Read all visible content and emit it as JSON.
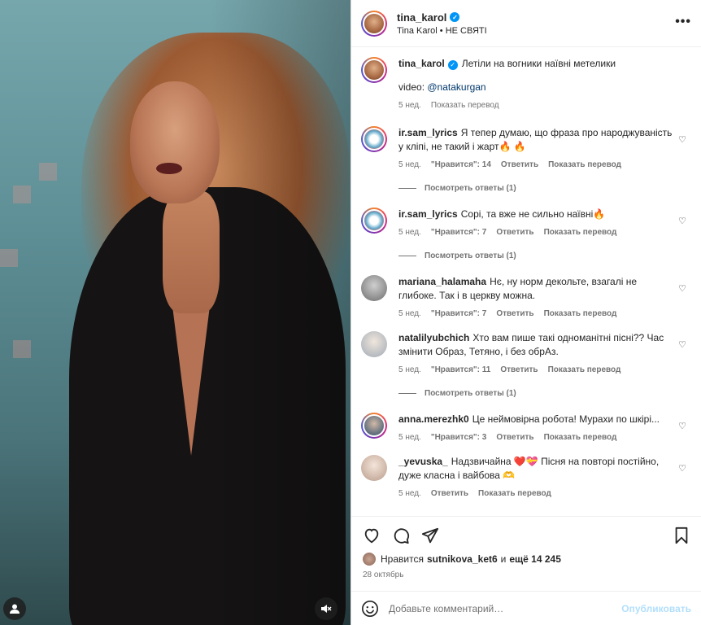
{
  "post": {
    "username": "tina_karol",
    "subtitle": "Tina Karol • НЕ СВЯТІ",
    "caption": "Летіли на вогники наївні метелики",
    "caption_video_prefix": "video: ",
    "caption_video_link": "@natakurgan",
    "caption_time": "5 нед.",
    "translate": "Показать перевод"
  },
  "comments": [
    {
      "user": "ir.sam_lyrics",
      "text": "Я тепер думаю, що фраза про народжуваність у кліпі, не такий і жарт🔥 🔥",
      "time": "5 нед.",
      "likes": "\"Нравится\": 14",
      "reply": "Ответить",
      "translate": "Показать перевод",
      "replies": "Посмотреть ответы (1)"
    },
    {
      "user": "ir.sam_lyrics",
      "text": "Сорі, та вже не сильно наївні🔥",
      "time": "5 нед.",
      "likes": "\"Нравится\": 7",
      "reply": "Ответить",
      "translate": "Показать перевод",
      "replies": "Посмотреть ответы (1)"
    },
    {
      "user": "mariana_halamaha",
      "text": "Нє, ну норм декольте, взагалі не глибоке. Так і в церкву можна.",
      "time": "5 нед.",
      "likes": "\"Нравится\": 7",
      "reply": "Ответить",
      "translate": "Показать перевод"
    },
    {
      "user": "natalilyubchich",
      "text": "Хто вам пише такі одноманітні пісні?? Час змінити Образ, Тетяно, і без обрАз.",
      "time": "5 нед.",
      "likes": "\"Нравится\": 11",
      "reply": "Ответить",
      "translate": "Показать перевод",
      "replies": "Посмотреть ответы (1)"
    },
    {
      "user": "anna.merezhk0",
      "text": "Це неймовірна робота! Мурахи по шкірі...",
      "time": "5 нед.",
      "likes": "\"Нравится\": 3",
      "reply": "Ответить",
      "translate": "Показать перевод"
    },
    {
      "user": "_yevuska_",
      "text": "Надзвичайна ❤️💝 Пісня на повторі постійно, дуже класна і вайбова 🫶",
      "time": "5 нед.",
      "reply": "Ответить",
      "translate": "Показать перевод"
    }
  ],
  "footer": {
    "likes_prefix": "Нравится",
    "likes_user": "sutnikova_ket6",
    "likes_and": "и",
    "likes_more": "ещё 14 245",
    "date": "28 октябрь",
    "comment_placeholder": "Добавьте комментарий…",
    "publish": "Опубликовать"
  },
  "colors": {
    "accent": "#0095f6",
    "link": "#00376b",
    "muted": "#737373",
    "publish_disabled": "#b2dffc"
  }
}
